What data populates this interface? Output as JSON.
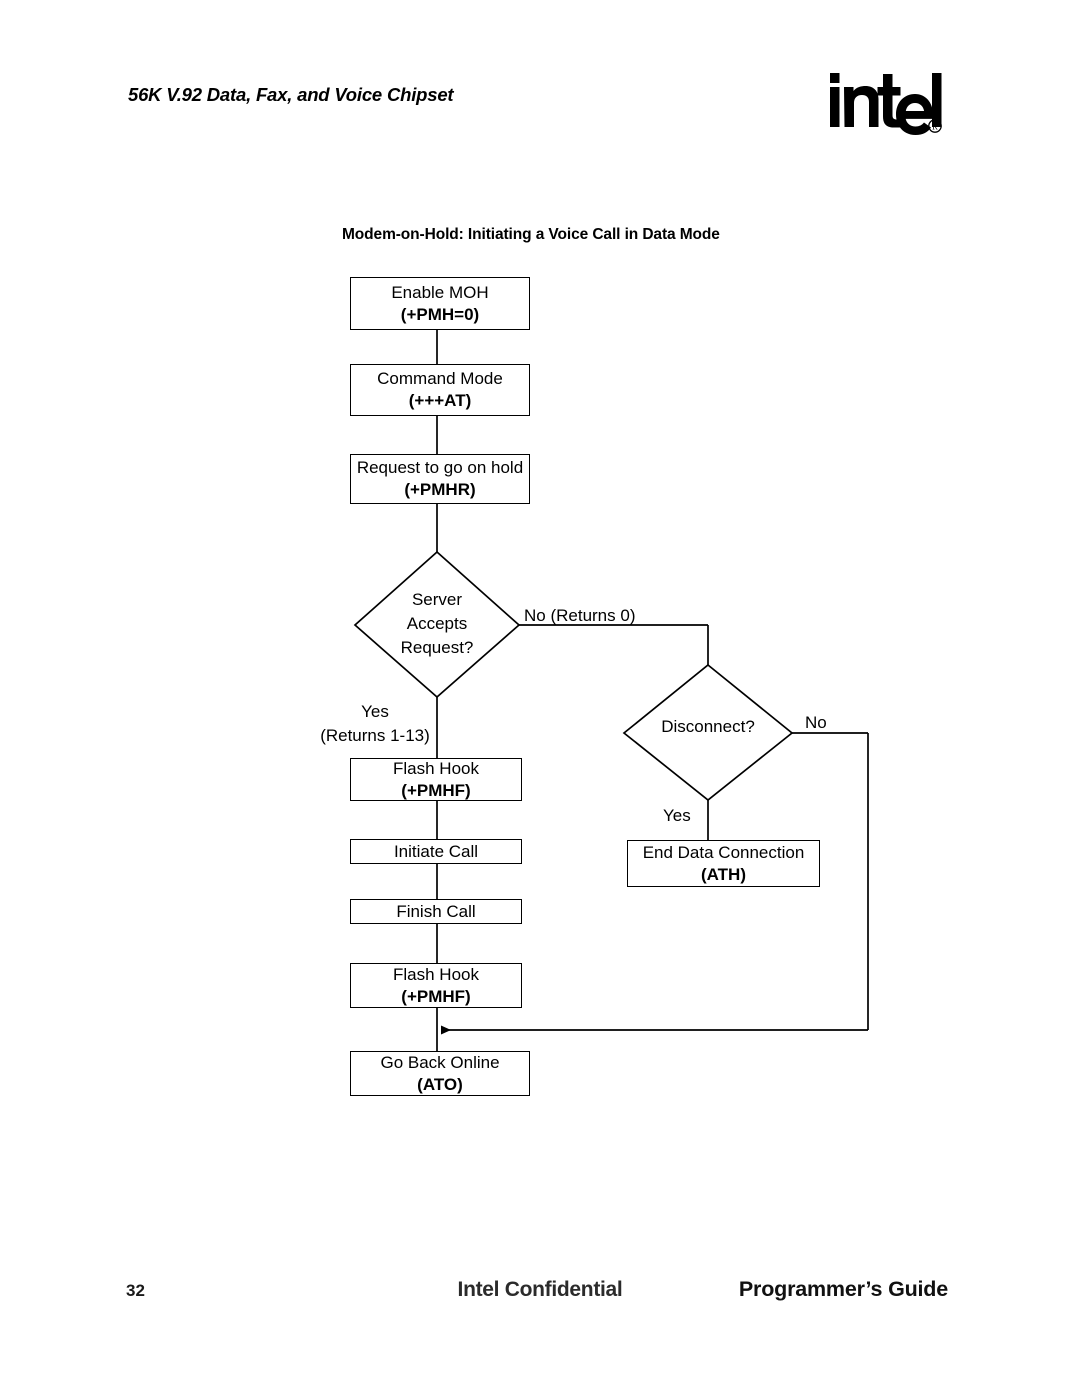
{
  "header": {
    "title": "56K V.92 Data, Fax, and Voice Chipset",
    "logo_name": "intel-logo",
    "logo_text": "intel",
    "logo_mark": "®"
  },
  "diagram": {
    "title": "Modem-on-Hold: Initiating a Voice Call in Data Mode",
    "nodes": [
      {
        "id": "enable-moh",
        "line1": "Enable MOH",
        "line2": "(+PMH=0)"
      },
      {
        "id": "command-mode",
        "line1": "Command Mode",
        "line2": "(+++AT)"
      },
      {
        "id": "request-hold",
        "line1": "Request to go on hold",
        "line2": "(+PMHR)"
      },
      {
        "id": "flash-hook-1",
        "line1": "Flash Hook",
        "line2": "(+PMHF)"
      },
      {
        "id": "initiate-call",
        "line1": "Initiate Call",
        "line2": ""
      },
      {
        "id": "finish-call",
        "line1": "Finish Call",
        "line2": ""
      },
      {
        "id": "flash-hook-2",
        "line1": "Flash Hook",
        "line2": "(+PMHF)"
      },
      {
        "id": "go-back-online",
        "line1": "Go Back Online",
        "line2": "(ATO)"
      },
      {
        "id": "end-data-conn",
        "line1": "End Data Connection",
        "line2": "(ATH)"
      }
    ],
    "decisions": [
      {
        "id": "server-accepts",
        "line1": "Server",
        "line2": "Accepts",
        "line3": "Request?"
      },
      {
        "id": "disconnect",
        "line1": "Disconnect?",
        "line2": "",
        "line3": ""
      }
    ],
    "edge_labels": {
      "server_no": "No (Returns 0)",
      "server_yes_1": "Yes",
      "server_yes_2": "(Returns 1-13)",
      "disconnect_no": "No",
      "disconnect_yes": "Yes"
    },
    "line_color": "#000000"
  },
  "footer": {
    "page_number": "32",
    "center": "Intel Confidential",
    "right": "Programmer’s Guide"
  }
}
